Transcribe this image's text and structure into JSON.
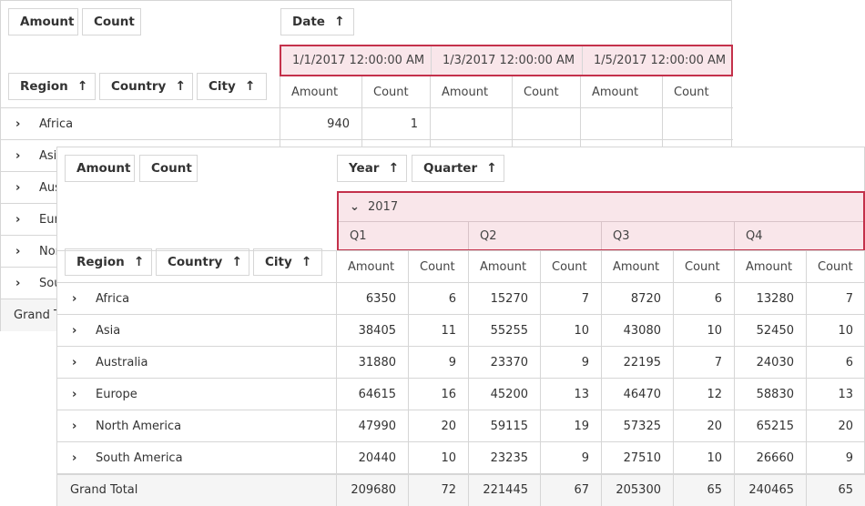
{
  "back_grid": {
    "data_fields": [
      "Amount",
      "Count"
    ],
    "column_fields": [
      {
        "label": "Date",
        "sort": "↑"
      }
    ],
    "row_fields": [
      {
        "label": "Region",
        "sort": "↑"
      },
      {
        "label": "Country",
        "sort": "↑"
      },
      {
        "label": "City",
        "sort": "↑"
      }
    ],
    "column_headers": [
      "1/1/2017 12:00:00 AM",
      "1/3/2017 12:00:00 AM",
      "1/5/2017 12:00:00 AM"
    ],
    "measure_headers": [
      "Amount",
      "Count",
      "Amount",
      "Count",
      "Amount",
      "Count"
    ],
    "rows": [
      {
        "label": "Africa",
        "values": [
          "940",
          "1",
          "",
          "",
          "",
          ""
        ]
      },
      {
        "label": "Asia"
      },
      {
        "label": "Australia"
      },
      {
        "label": "Europe"
      },
      {
        "label": "North America"
      },
      {
        "label": "South America"
      }
    ],
    "grand_total_label": "Grand Total"
  },
  "front_grid": {
    "data_fields": [
      "Amount",
      "Count"
    ],
    "column_fields": [
      {
        "label": "Year",
        "sort": "↑"
      },
      {
        "label": "Quarter",
        "sort": "↑"
      }
    ],
    "row_fields": [
      {
        "label": "Region",
        "sort": "↑"
      },
      {
        "label": "Country",
        "sort": "↑"
      },
      {
        "label": "City",
        "sort": "↑"
      }
    ],
    "year_header": "2017",
    "quarter_headers": [
      "Q1",
      "Q2",
      "Q3",
      "Q4"
    ],
    "measure_headers": [
      "Amount",
      "Count",
      "Amount",
      "Count",
      "Amount",
      "Count",
      "Amount",
      "Count"
    ],
    "rows": [
      {
        "label": "Africa",
        "values": [
          "6350",
          "6",
          "15270",
          "7",
          "8720",
          "6",
          "13280",
          "7"
        ]
      },
      {
        "label": "Asia",
        "values": [
          "38405",
          "11",
          "55255",
          "10",
          "43080",
          "10",
          "52450",
          "10"
        ]
      },
      {
        "label": "Australia",
        "values": [
          "31880",
          "9",
          "23370",
          "9",
          "22195",
          "7",
          "24030",
          "6"
        ]
      },
      {
        "label": "Europe",
        "values": [
          "64615",
          "16",
          "45200",
          "13",
          "46470",
          "12",
          "58830",
          "13"
        ]
      },
      {
        "label": "North America",
        "values": [
          "47990",
          "20",
          "59115",
          "19",
          "57325",
          "20",
          "65215",
          "20"
        ]
      },
      {
        "label": "South America",
        "values": [
          "20440",
          "10",
          "23235",
          "9",
          "27510",
          "10",
          "26660",
          "9"
        ]
      }
    ],
    "grand_total": {
      "label": "Grand Total",
      "values": [
        "209680",
        "72",
        "221445",
        "67",
        "205300",
        "65",
        "240465",
        "65"
      ]
    }
  },
  "icons": {
    "collapsed": "›",
    "expanded": "⌄",
    "sort_asc": "↑"
  },
  "colors": {
    "highlight_border": "#c4314b",
    "highlight_fill": "#f9e6ea",
    "grid_line": "#d6d6d6",
    "grand_total_bg": "#f5f5f5"
  }
}
